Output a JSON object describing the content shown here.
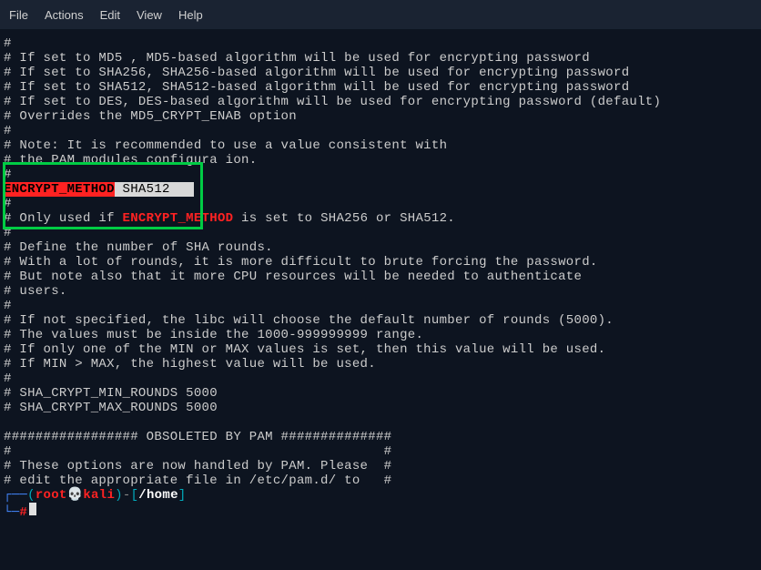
{
  "menu": {
    "file": "File",
    "actions": "Actions",
    "edit": "Edit",
    "view": "View",
    "help": "Help"
  },
  "lines": {
    "l01": "#",
    "l02": "# If set to MD5 , MD5-based algorithm will be used for encrypting password",
    "l03": "# If set to SHA256, SHA256-based algorithm will be used for encrypting password",
    "l04": "# If set to SHA512, SHA512-based algorithm will be used for encrypting password",
    "l05": "# If set to DES, DES-based algorithm will be used for encrypting password (default)",
    "l06": "# Overrides the MD5_CRYPT_ENAB option",
    "l07": "#",
    "l08": "# Note: It is recommended to use a value consistent with",
    "l09": "# the PAM modules configura ion.",
    "l10": "#",
    "l11a": "ENCRYPT_METHOD",
    "l11b": " SHA512   ",
    "l12": "#",
    "l13a": "# Only used if ",
    "l13b": "ENCRYPT_METHOD",
    "l13c": " is set to SHA256 or SHA512.",
    "l14": "#",
    "l15": "# Define the number of SHA rounds.",
    "l16": "# With a lot of rounds, it is more difficult to brute forcing the password.",
    "l17": "# But note also that it more CPU resources will be needed to authenticate",
    "l18": "# users.",
    "l19": "#",
    "l20": "# If not specified, the libc will choose the default number of rounds (5000).",
    "l21": "# The values must be inside the 1000-999999999 range.",
    "l22": "# If only one of the MIN or MAX values is set, then this value will be used.",
    "l23": "# If MIN > MAX, the highest value will be used.",
    "l24": "#",
    "l25": "# SHA_CRYPT_MIN_ROUNDS 5000",
    "l26": "# SHA_CRYPT_MAX_ROUNDS 5000",
    "l27": "",
    "l28": "################# OBSOLETED BY PAM ##############",
    "l29": "#                                               #",
    "l30": "# These options are now handled by PAM. Please  #",
    "l31": "# edit the appropriate file in /etc/pam.d/ to   #"
  },
  "prompt": {
    "corner_top": "┌──",
    "paren_open": "(",
    "user": "root",
    "skull": "💀",
    "host": "kali",
    "paren_close": ")",
    "dash": "-",
    "bracket_open": "[",
    "path": "/home",
    "bracket_close": "]",
    "corner_bottom": "└─",
    "hash": "#"
  }
}
